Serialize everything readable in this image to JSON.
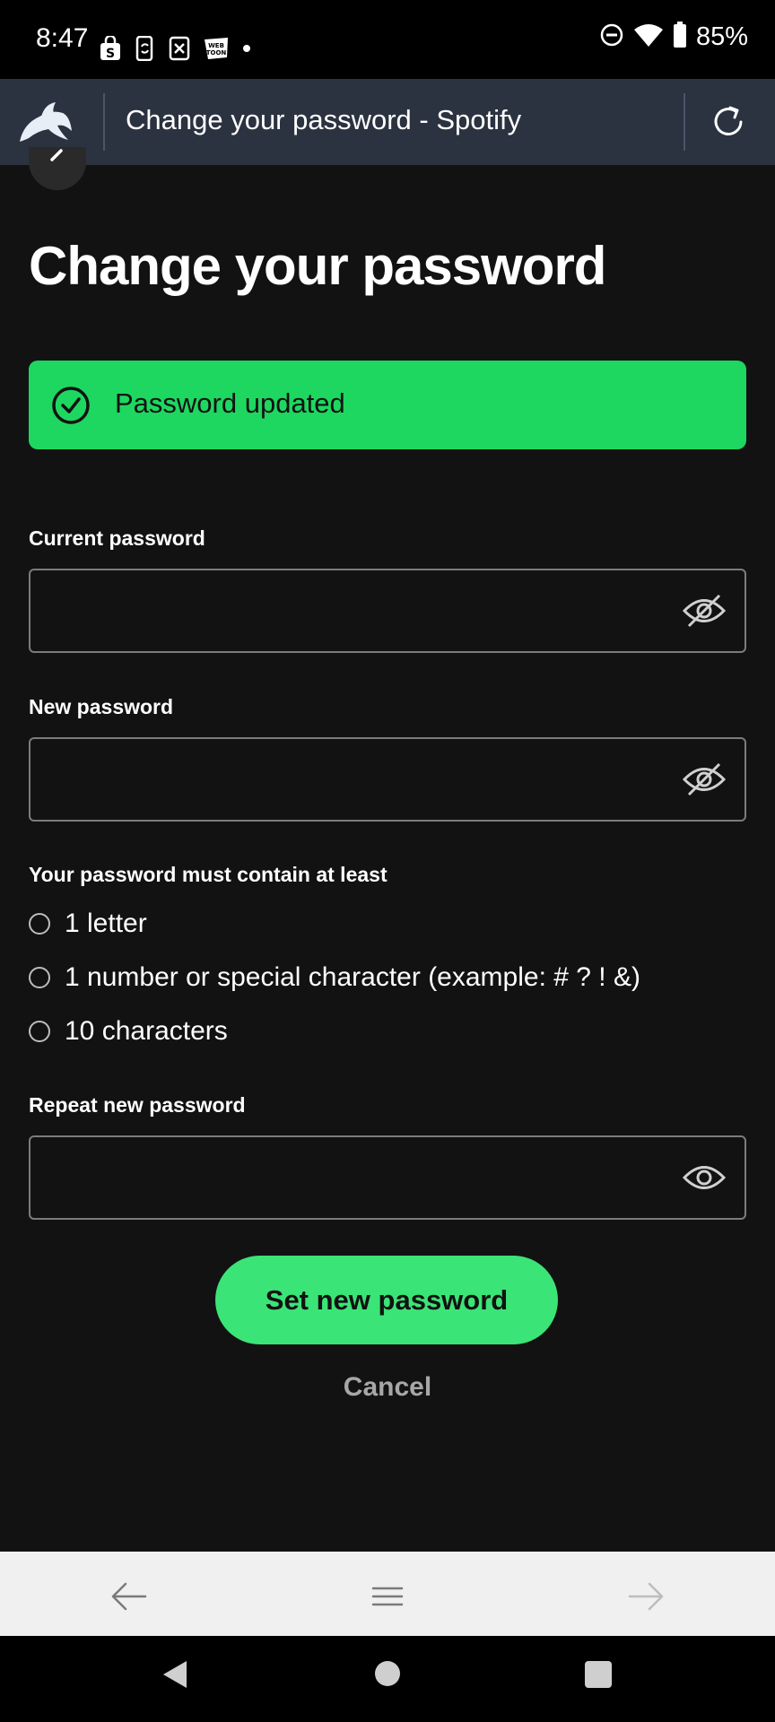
{
  "status_bar": {
    "time": "8:47",
    "battery": "85%",
    "icons_left": [
      "shopping-bag-icon",
      "phone-sync-icon",
      "close-box-icon",
      "webtoon-icon",
      "dot-icon"
    ],
    "icons_right": [
      "do-not-disturb-icon",
      "wifi-icon",
      "battery-icon"
    ]
  },
  "browser": {
    "title": "Change your password - Spotify",
    "logo": "dolphin-browser-logo",
    "reload_icon": "reload-icon"
  },
  "page": {
    "title": "Change your password",
    "alert": {
      "text": "Password updated",
      "color": "#1ed760",
      "icon": "check-circle-icon"
    },
    "fields": {
      "current_label": "Current password",
      "current_value": "",
      "new_label": "New password",
      "new_value": "",
      "repeat_label": "Repeat new password",
      "repeat_value": ""
    },
    "requirements": {
      "title": "Your password must contain at least",
      "items": [
        "1 letter",
        "1 number or special character (example: # ? ! &)",
        "10 characters"
      ]
    },
    "primary_button": "Set new password",
    "primary_color": "#3be477",
    "cancel_button": "Cancel"
  },
  "browser_bottom": {
    "icons": [
      "arrow-left-icon",
      "menu-icon",
      "arrow-right-icon"
    ]
  },
  "nav_bar": {
    "icons": [
      "nav-back-icon",
      "nav-home-icon",
      "nav-recents-icon"
    ]
  }
}
